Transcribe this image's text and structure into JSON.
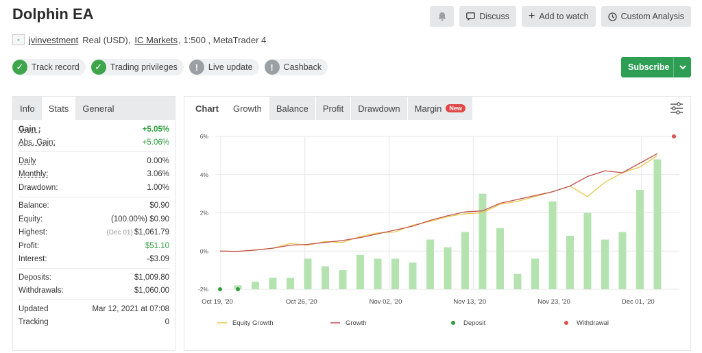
{
  "page": {
    "title": "Dolphin EA",
    "account_user": "jvinvestment",
    "account_type": "Real (USD),",
    "broker": "IC Markets",
    "meta_rest": ", 1:500 , MetaTrader 4",
    "logo_text": "⚬"
  },
  "actions": {
    "discuss": "Discuss",
    "add_watch": "Add to watch",
    "custom_analysis": "Custom Analysis",
    "subscribe": "Subscribe"
  },
  "badges": [
    {
      "label": "Track record",
      "status": "ok"
    },
    {
      "label": "Trading privileges",
      "status": "ok"
    },
    {
      "label": "Live update",
      "status": "na"
    },
    {
      "label": "Cashback",
      "status": "na"
    }
  ],
  "stats_tabs": [
    "Info",
    "Stats",
    "General"
  ],
  "stats": {
    "gain_k": "Gain :",
    "gain_v": "+5.05%",
    "abs_gain_k": "Abs. Gain:",
    "abs_gain_v": "+5.06%",
    "daily_k": "Daily",
    "daily_v": "0.00%",
    "monthly_k": "Monthly:",
    "monthly_v": "3.06%",
    "drawdown_k": "Drawdown:",
    "drawdown_v": "1.00%",
    "balance_k": "Balance:",
    "balance_v": "$0.90",
    "equity_k": "Equity:",
    "equity_sub": "(100.00%)",
    "equity_v": "$0.90",
    "highest_k": "Highest:",
    "highest_sub": "(Dec 01)",
    "highest_v": "$1,061.79",
    "profit_k": "Profit:",
    "profit_v": "$51.10",
    "interest_k": "Interest:",
    "interest_v": "-$3.09",
    "deposits_k": "Deposits:",
    "deposits_v": "$1,009.80",
    "withdrawals_k": "Withdrawals:",
    "withdrawals_v": "$1,060.00",
    "updated_k": "Updated",
    "updated_v": "Mar 12, 2021 at 07:08",
    "tracking_k": "Tracking",
    "tracking_v": "0"
  },
  "chart_tabs": {
    "chart": "Chart",
    "growth": "Growth",
    "balance": "Balance",
    "profit": "Profit",
    "drawdown": "Drawdown",
    "margin": "Margin",
    "new": "New"
  },
  "colors": {
    "equity": "#e8c84a",
    "growth": "#c0504d",
    "deposit": "#2e9e3e",
    "withdrawal": "#d9534f",
    "bar": "#b5e3b0"
  },
  "chart_data": {
    "type": "bar",
    "ylim": [
      -2,
      6
    ],
    "yticks": [
      "6%",
      "4%",
      "2%",
      "0%",
      "-2%"
    ],
    "yvalues": [
      6,
      4,
      2,
      0,
      -2
    ],
    "xticks": [
      "Oct 19, '20",
      "Oct 26, '20",
      "Nov 02, '20",
      "Nov 13, '20",
      "Nov 23, '20",
      "Dec 01, '20"
    ],
    "legend": [
      "Equity Growth",
      "Growth",
      "Deposit",
      "Withdrawal"
    ],
    "bars": [
      -1.8,
      -1.6,
      -1.4,
      -1.4,
      -0.4,
      -0.8,
      -1.0,
      -0.2,
      -0.4,
      -0.4,
      -0.6,
      0.6,
      0.2,
      1.0,
      3.0,
      1.2,
      -1.2,
      -0.4,
      2.6,
      0.8,
      2.0,
      0.6,
      1.0,
      3.2,
      4.8
    ],
    "growth": [
      0.0,
      -0.02,
      0.05,
      0.15,
      0.3,
      0.35,
      0.45,
      0.55,
      0.7,
      0.9,
      1.1,
      1.3,
      1.6,
      1.85,
      2.05,
      2.1,
      2.5,
      2.7,
      2.9,
      3.1,
      3.4,
      3.9,
      4.2,
      4.1,
      4.6,
      5.1
    ],
    "equity": [
      0.0,
      -0.02,
      0.06,
      0.14,
      0.4,
      0.3,
      0.5,
      0.45,
      0.75,
      0.95,
      1.0,
      1.35,
      1.55,
      1.8,
      1.95,
      2.0,
      2.45,
      2.6,
      2.85,
      3.1,
      3.4,
      2.85,
      3.6,
      4.1,
      4.4,
      5.0
    ],
    "deposits": [
      -2,
      -2
    ],
    "withdrawal": [
      6
    ]
  }
}
